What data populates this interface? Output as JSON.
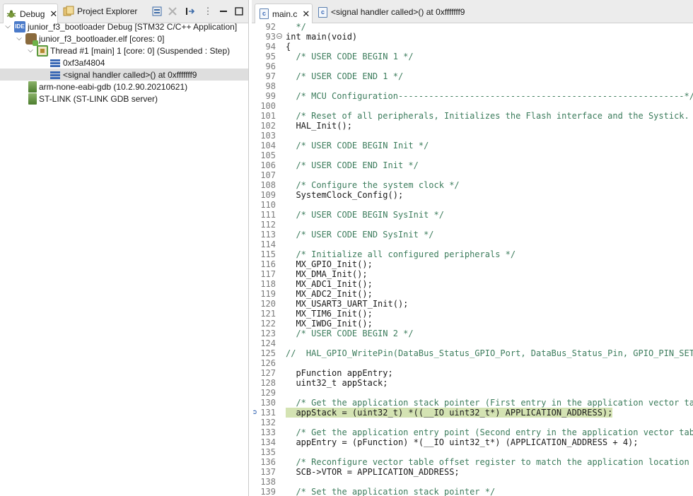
{
  "left": {
    "tabs": {
      "debug": "Debug",
      "project_explorer": "Project Explorer"
    },
    "toolbar_icons": [
      "collapse-all-icon",
      "remove-all-icon",
      "step-filter-icon",
      "view-menu-icon",
      "minimize-icon",
      "maximize-icon"
    ],
    "tree": [
      {
        "label": "junior_f3_bootloader Debug [STM32 C/C++ Application]",
        "icon": "ide-launch-icon"
      },
      {
        "label": "junior_f3_bootloader.elf [cores: 0]",
        "icon": "debug-target-icon"
      },
      {
        "label": "Thread #1 [main] 1 [core: 0] (Suspended : Step)",
        "icon": "thread-icon"
      },
      {
        "label": "0xf3af4804",
        "icon": "stack-frame-icon"
      },
      {
        "label": "<signal handler called>() at 0xfffffff9",
        "icon": "stack-frame-icon"
      },
      {
        "label": "arm-none-eabi-gdb (10.2.90.20210621)",
        "icon": "process-icon"
      },
      {
        "label": "ST-LINK (ST-LINK GDB server)",
        "icon": "process-icon"
      }
    ]
  },
  "editor": {
    "tabs": {
      "main": "main.c",
      "signal": "<signal handler called>() at 0xfffffff9"
    },
    "current_line": "131",
    "lines": [
      {
        "n": "92",
        "t": "  */"
      },
      {
        "n": "93",
        "t": "int main(void)"
      },
      {
        "n": "94",
        "t": "{"
      },
      {
        "n": "95",
        "t": "  /* USER CODE BEGIN 1 */"
      },
      {
        "n": "96",
        "t": ""
      },
      {
        "n": "97",
        "t": "  /* USER CODE END 1 */"
      },
      {
        "n": "98",
        "t": ""
      },
      {
        "n": "99",
        "t": "  /* MCU Configuration--------------------------------------------------------*/"
      },
      {
        "n": "100",
        "t": ""
      },
      {
        "n": "101",
        "t": "  /* Reset of all peripherals, Initializes the Flash interface and the Systick. */"
      },
      {
        "n": "102",
        "t": "  HAL_Init();"
      },
      {
        "n": "103",
        "t": ""
      },
      {
        "n": "104",
        "t": "  /* USER CODE BEGIN Init */"
      },
      {
        "n": "105",
        "t": ""
      },
      {
        "n": "106",
        "t": "  /* USER CODE END Init */"
      },
      {
        "n": "107",
        "t": ""
      },
      {
        "n": "108",
        "t": "  /* Configure the system clock */"
      },
      {
        "n": "109",
        "t": "  SystemClock_Config();"
      },
      {
        "n": "110",
        "t": ""
      },
      {
        "n": "111",
        "t": "  /* USER CODE BEGIN SysInit */"
      },
      {
        "n": "112",
        "t": ""
      },
      {
        "n": "113",
        "t": "  /* USER CODE END SysInit */"
      },
      {
        "n": "114",
        "t": ""
      },
      {
        "n": "115",
        "t": "  /* Initialize all configured peripherals */"
      },
      {
        "n": "116",
        "t": "  MX_GPIO_Init();"
      },
      {
        "n": "117",
        "t": "  MX_DMA_Init();"
      },
      {
        "n": "118",
        "t": "  MX_ADC1_Init();"
      },
      {
        "n": "119",
        "t": "  MX_ADC2_Init();"
      },
      {
        "n": "120",
        "t": "  MX_USART3_UART_Init();"
      },
      {
        "n": "121",
        "t": "  MX_TIM6_Init();"
      },
      {
        "n": "122",
        "t": "  MX_IWDG_Init();"
      },
      {
        "n": "123",
        "t": "  /* USER CODE BEGIN 2 */"
      },
      {
        "n": "124",
        "t": ""
      },
      {
        "n": "125",
        "t": "//  HAL_GPIO_WritePin(DataBus_Status_GPIO_Port, DataBus_Status_Pin, GPIO_PIN_SET);"
      },
      {
        "n": "126",
        "t": ""
      },
      {
        "n": "127",
        "t": "  pFunction appEntry;"
      },
      {
        "n": "128",
        "t": "  uint32_t appStack;"
      },
      {
        "n": "129",
        "t": ""
      },
      {
        "n": "130",
        "t": "  /* Get the application stack pointer (First entry in the application vector table) */"
      },
      {
        "n": "131",
        "t": "  appStack = (uint32_t) *((__IO uint32_t*) APPLICATION_ADDRESS);"
      },
      {
        "n": "132",
        "t": ""
      },
      {
        "n": "133",
        "t": "  /* Get the application entry point (Second entry in the application vector table) */"
      },
      {
        "n": "134",
        "t": "  appEntry = (pFunction) *(__IO uint32_t*) (APPLICATION_ADDRESS + 4);"
      },
      {
        "n": "135",
        "t": ""
      },
      {
        "n": "136",
        "t": "  /* Reconfigure vector table offset register to match the application location */"
      },
      {
        "n": "137",
        "t": "  SCB->VTOR = APPLICATION_ADDRESS;"
      },
      {
        "n": "138",
        "t": ""
      },
      {
        "n": "139",
        "t": "  /* Set the application stack pointer */"
      }
    ]
  },
  "colors": {
    "current_line_highlight": "#d4e3b3",
    "comment": "#3c7c5c",
    "keyword": "#7f0055",
    "selection": "#dedede"
  }
}
